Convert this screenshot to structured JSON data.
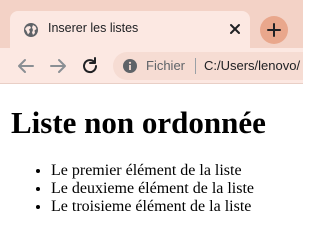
{
  "browser": {
    "tab": {
      "title": "Inserer les listes",
      "favicon_icon": "globe-icon",
      "close_icon": "close-icon"
    },
    "new_tab_icon": "plus-icon",
    "toolbar": {
      "back_icon": "arrow-left-icon",
      "forward_icon": "arrow-right-icon",
      "reload_icon": "reload-icon"
    },
    "omnibox": {
      "info_icon": "info-icon",
      "scheme_label": "Fichier",
      "url": "C:/Users/lenovo/"
    },
    "colors": {
      "tabstrip": "#f3d2c6",
      "tab_active": "#fce8e2",
      "new_tab_button": "#e9a78c"
    }
  },
  "page": {
    "heading": "Liste non ordonnée",
    "list_items": [
      "Le premier élément de la liste",
      "Le deuxieme élément de la liste",
      "Le troisieme élément de la liste"
    ]
  }
}
